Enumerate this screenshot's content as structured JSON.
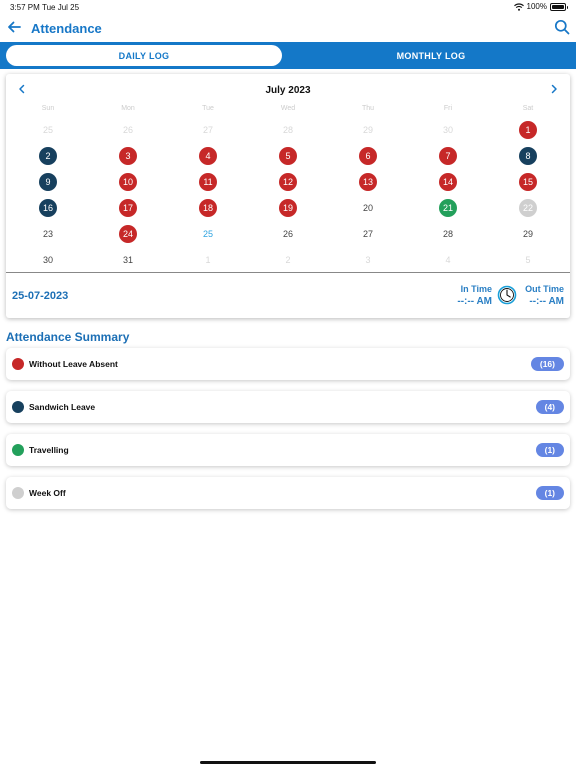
{
  "status_bar": {
    "time": "3:57 PM",
    "date": "Tue Jul 25",
    "battery": "100%"
  },
  "header": {
    "title": "Attendance"
  },
  "tabs": [
    {
      "label": "DAILY LOG",
      "active": true
    },
    {
      "label": "MONTHLY LOG",
      "active": false
    }
  ],
  "calendar": {
    "month_title": "July 2023",
    "weekdays": [
      "Sun",
      "Mon",
      "Tue",
      "Wed",
      "Thu",
      "Fri",
      "Sat"
    ],
    "days": [
      {
        "d": "25",
        "s": "outside"
      },
      {
        "d": "26",
        "s": "outside"
      },
      {
        "d": "27",
        "s": "outside"
      },
      {
        "d": "28",
        "s": "outside"
      },
      {
        "d": "29",
        "s": "outside"
      },
      {
        "d": "30",
        "s": "outside"
      },
      {
        "d": "1",
        "s": "absent"
      },
      {
        "d": "2",
        "s": "sandwich"
      },
      {
        "d": "3",
        "s": "absent"
      },
      {
        "d": "4",
        "s": "absent"
      },
      {
        "d": "5",
        "s": "absent"
      },
      {
        "d": "6",
        "s": "absent"
      },
      {
        "d": "7",
        "s": "absent"
      },
      {
        "d": "8",
        "s": "sandwich"
      },
      {
        "d": "9",
        "s": "sandwich"
      },
      {
        "d": "10",
        "s": "absent"
      },
      {
        "d": "11",
        "s": "absent"
      },
      {
        "d": "12",
        "s": "absent"
      },
      {
        "d": "13",
        "s": "absent"
      },
      {
        "d": "14",
        "s": "absent"
      },
      {
        "d": "15",
        "s": "absent"
      },
      {
        "d": "16",
        "s": "sandwich"
      },
      {
        "d": "17",
        "s": "absent"
      },
      {
        "d": "18",
        "s": "absent"
      },
      {
        "d": "19",
        "s": "absent"
      },
      {
        "d": "20",
        "s": "none"
      },
      {
        "d": "21",
        "s": "travel"
      },
      {
        "d": "22",
        "s": "weekoff"
      },
      {
        "d": "23",
        "s": "none"
      },
      {
        "d": "24",
        "s": "absent"
      },
      {
        "d": "25",
        "s": "today"
      },
      {
        "d": "26",
        "s": "none"
      },
      {
        "d": "27",
        "s": "none"
      },
      {
        "d": "28",
        "s": "none"
      },
      {
        "d": "29",
        "s": "none"
      },
      {
        "d": "30",
        "s": "none"
      },
      {
        "d": "31",
        "s": "none"
      },
      {
        "d": "1",
        "s": "outside"
      },
      {
        "d": "2",
        "s": "outside"
      },
      {
        "d": "3",
        "s": "outside"
      },
      {
        "d": "4",
        "s": "outside"
      },
      {
        "d": "5",
        "s": "outside"
      }
    ]
  },
  "selected": {
    "date": "25-07-2023",
    "in_label": "In Time",
    "in_value": "--:-- AM",
    "out_label": "Out Time",
    "out_value": "--:-- AM"
  },
  "summary": {
    "title": "Attendance Summary",
    "items": [
      {
        "label": "Without Leave Absent",
        "count": "(16)",
        "color": "#c62828"
      },
      {
        "label": "Sandwich Leave",
        "count": "(4)",
        "color": "#17405e"
      },
      {
        "label": "Travelling",
        "count": "(1)",
        "color": "#23a05b"
      },
      {
        "label": "Week Off",
        "count": "(1)",
        "color": "#cfcfcf"
      }
    ]
  },
  "colors": {
    "primary": "#1478c8",
    "absent": "#c62828",
    "sandwich": "#17405e",
    "travel": "#23a05b",
    "weekoff": "#cfcfcf",
    "badge": "#6486e3"
  }
}
